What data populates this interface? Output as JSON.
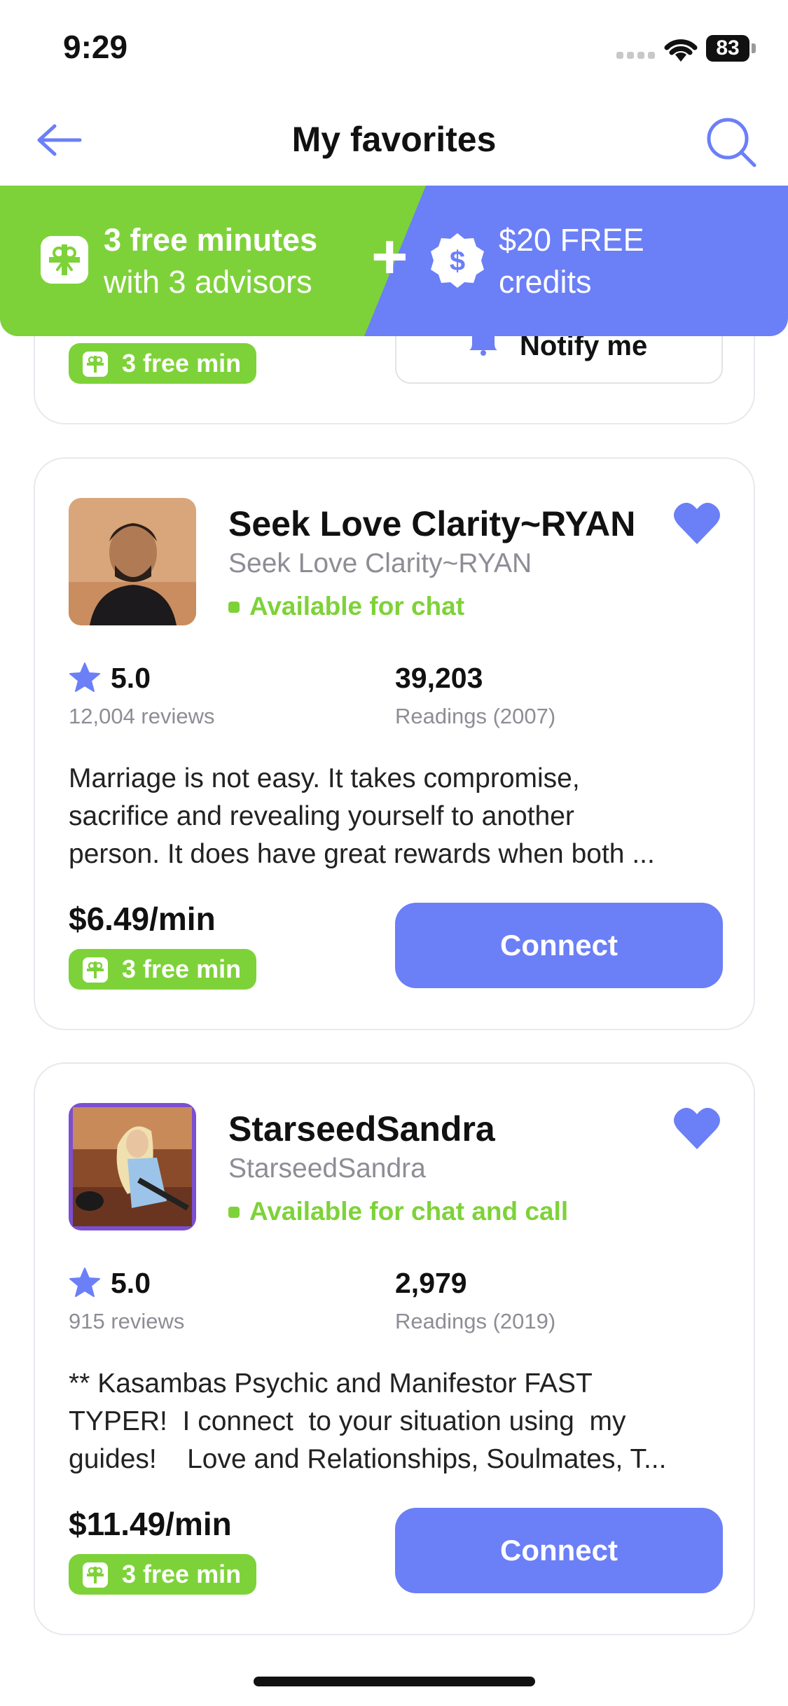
{
  "status_bar": {
    "time": "9:29",
    "battery": "83"
  },
  "nav": {
    "title": "My favorites",
    "back_icon": "arrow-left-icon",
    "search_icon": "search-icon"
  },
  "promo": {
    "left_line1": "3 free minutes",
    "left_line2": "with 3 advisors",
    "plus": "+",
    "right_line1": "$20 FREE",
    "right_line2": "credits",
    "colors": {
      "green": "#7ed239",
      "blue": "#6b7ff7"
    }
  },
  "partial_card": {
    "free_label": "3 free min",
    "notify_label": "Notify me"
  },
  "advisors": [
    {
      "name": "Seek Love Clarity~RYAN",
      "subtitle": "Seek Love Clarity~RYAN",
      "availability": "Available for chat",
      "rating": "5.0",
      "reviews": "12,004 reviews",
      "readings": "39,203",
      "readings_label": "Readings (2007)",
      "description": [
        "Marriage is not easy. It takes compromise,",
        "sacrifice and revealing yourself to another",
        "person. It does have great rewards when both ..."
      ],
      "price": "$6.49/min",
      "free_label": "3 free min",
      "connect_label": "Connect"
    },
    {
      "name": "StarseedSandra",
      "subtitle": "StarseedSandra",
      "availability": "Available for chat and call",
      "rating": "5.0",
      "reviews": "915 reviews",
      "readings": "2,979",
      "readings_label": "Readings (2019)",
      "description": [
        "** Kasambas Psychic and Manifestor FAST",
        "TYPER!  I connect  to your situation using  my",
        "guides!    Love and Relationships, Soulmates, T..."
      ],
      "price": "$11.49/min",
      "free_label": "3 free min",
      "connect_label": "Connect"
    }
  ]
}
